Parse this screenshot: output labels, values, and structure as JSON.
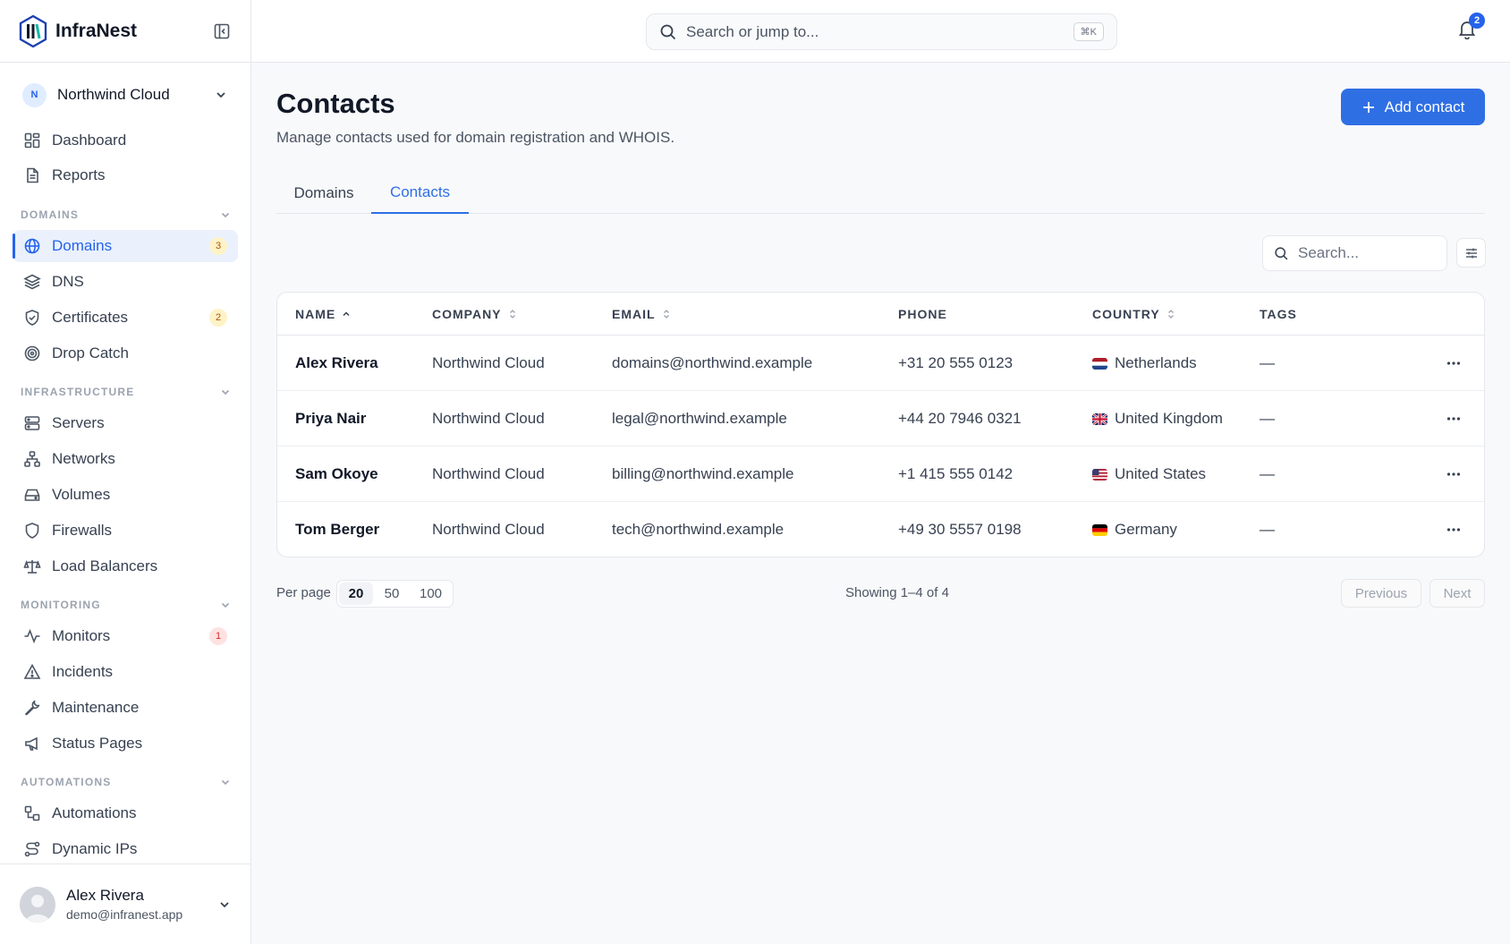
{
  "app": {
    "name": "InfraNest"
  },
  "org": {
    "initial": "N",
    "name": "Northwind Cloud"
  },
  "nav": {
    "top": [
      {
        "label": "Dashboard",
        "icon": "dashboard-icon"
      },
      {
        "label": "Reports",
        "icon": "file-text-icon"
      }
    ],
    "sections": {
      "domains": "DOMAINS",
      "infrastructure": "INFRASTRUCTURE",
      "monitoring": "MONITORING",
      "automations": "AUTOMATIONS"
    },
    "domains_items": [
      {
        "label": "Domains",
        "badge": "3",
        "icon": "globe-icon"
      },
      {
        "label": "DNS",
        "icon": "layers-icon"
      },
      {
        "label": "Certificates",
        "badge": "2",
        "icon": "shield-check-icon"
      },
      {
        "label": "Drop Catch",
        "icon": "target-icon"
      }
    ],
    "infra_items": [
      {
        "label": "Servers",
        "icon": "server-icon"
      },
      {
        "label": "Networks",
        "icon": "network-icon"
      },
      {
        "label": "Volumes",
        "icon": "hard-drive-icon"
      },
      {
        "label": "Firewalls",
        "icon": "shield-icon"
      },
      {
        "label": "Load Balancers",
        "icon": "scale-icon"
      }
    ],
    "monitoring_items": [
      {
        "label": "Monitors",
        "badge": "1",
        "icon": "activity-icon"
      },
      {
        "label": "Incidents",
        "icon": "alert-triangle-icon"
      },
      {
        "label": "Maintenance",
        "icon": "wrench-icon"
      },
      {
        "label": "Status Pages",
        "icon": "megaphone-icon"
      }
    ],
    "automation_items": [
      {
        "label": "Automations",
        "icon": "workflow-icon"
      },
      {
        "label": "Dynamic IPs",
        "icon": "route-icon"
      }
    ]
  },
  "user": {
    "name": "Alex Rivera",
    "email": "demo@infranest.app"
  },
  "topbar": {
    "search_placeholder": "Search or jump to...",
    "shortcut": "⌘K",
    "notifications": "2"
  },
  "page": {
    "title": "Contacts",
    "subtitle": "Manage contacts used for domain registration and WHOIS.",
    "add_label": "Add contact",
    "tabs": [
      "Domains",
      "Contacts"
    ],
    "active_tab": "Contacts"
  },
  "table": {
    "search_placeholder": "Search...",
    "columns": [
      "NAME",
      "COMPANY",
      "EMAIL",
      "PHONE",
      "COUNTRY",
      "TAGS"
    ],
    "rows": [
      {
        "name": "Alex Rivera",
        "company": "Northwind Cloud",
        "email": "domains@northwind.example",
        "phone": "+31 20 555 0123",
        "country": "Netherlands",
        "flag": "nl",
        "tags": "—"
      },
      {
        "name": "Priya Nair",
        "company": "Northwind Cloud",
        "email": "legal@northwind.example",
        "phone": "+44 20 7946 0321",
        "country": "United Kingdom",
        "flag": "gb",
        "tags": "—"
      },
      {
        "name": "Sam Okoye",
        "company": "Northwind Cloud",
        "email": "billing@northwind.example",
        "phone": "+1 415 555 0142",
        "country": "United States",
        "flag": "us",
        "tags": "—"
      },
      {
        "name": "Tom Berger",
        "company": "Northwind Cloud",
        "email": "tech@northwind.example",
        "phone": "+49 30 5557 0198",
        "country": "Germany",
        "flag": "de",
        "tags": "—"
      }
    ]
  },
  "pagination": {
    "per_page_label": "Per page",
    "options": [
      "20",
      "50",
      "100"
    ],
    "selected": "20",
    "showing": "Showing 1–4 of 4",
    "previous": "Previous",
    "next": "Next"
  },
  "colors": {
    "accent": "#2f6fe4",
    "active_bg": "#eaf1fd"
  }
}
